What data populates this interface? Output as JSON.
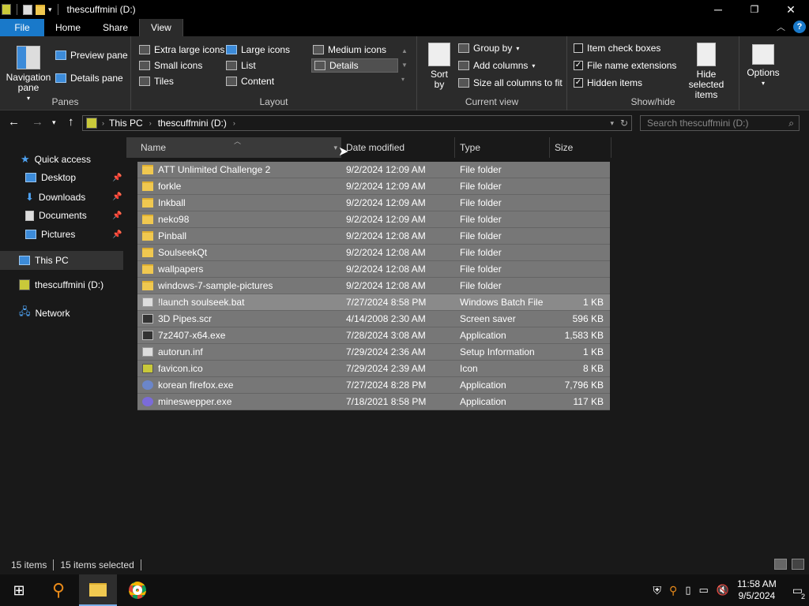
{
  "window": {
    "title": "thescuffmini (D:)",
    "controls": {
      "minimize": "─",
      "maximize": "❐",
      "close": "✕"
    }
  },
  "ribbon_tabs": [
    "File",
    "Home",
    "Share",
    "View"
  ],
  "ribbon": {
    "panes": {
      "navigation_pane": "Navigation pane",
      "preview_pane": "Preview pane",
      "details_pane": "Details pane",
      "label": "Panes"
    },
    "layout": {
      "items": [
        "Extra large icons",
        "Large icons",
        "Medium icons",
        "Small icons",
        "List",
        "Details",
        "Tiles",
        "Content"
      ],
      "selected": "Details",
      "label": "Layout"
    },
    "current_view": {
      "sort_by": "Sort by",
      "group_by": "Group by",
      "add_columns": "Add columns",
      "size_all_columns": "Size all columns to fit",
      "label": "Current view"
    },
    "show_hide": {
      "item_check_boxes": "Item check boxes",
      "file_name_extensions": "File name extensions",
      "hidden_items": "Hidden items",
      "hide_selected_items": "Hide selected items",
      "label": "Show/hide",
      "checks": {
        "item_check_boxes": false,
        "file_name_extensions": true,
        "hidden_items": true
      }
    },
    "options": "Options"
  },
  "address": {
    "crumbs": [
      "This PC",
      "thescuffmini (D:)"
    ],
    "search_placeholder": "Search thescuffmini (D:)"
  },
  "nav_pane": {
    "quick_access": "Quick access",
    "items": [
      "Desktop",
      "Downloads",
      "Documents",
      "Pictures"
    ],
    "this_pc": "This PC",
    "drive": "thescuffmini (D:)",
    "network": "Network"
  },
  "columns": [
    "Name",
    "Date modified",
    "Type",
    "Size"
  ],
  "files": [
    {
      "name": "ATT Unlimited Challenge 2",
      "date": "9/2/2024 12:09 AM",
      "type": "File folder",
      "size": "",
      "icon": "folder"
    },
    {
      "name": "forkle",
      "date": "9/2/2024 12:09 AM",
      "type": "File folder",
      "size": "",
      "icon": "folder"
    },
    {
      "name": "Inkball",
      "date": "9/2/2024 12:09 AM",
      "type": "File folder",
      "size": "",
      "icon": "folder"
    },
    {
      "name": "neko98",
      "date": "9/2/2024 12:09 AM",
      "type": "File folder",
      "size": "",
      "icon": "folder"
    },
    {
      "name": "Pinball",
      "date": "9/2/2024 12:08 AM",
      "type": "File folder",
      "size": "",
      "icon": "folder"
    },
    {
      "name": "SoulseekQt",
      "date": "9/2/2024 12:08 AM",
      "type": "File folder",
      "size": "",
      "icon": "folder"
    },
    {
      "name": "wallpapers",
      "date": "9/2/2024 12:08 AM",
      "type": "File folder",
      "size": "",
      "icon": "folder"
    },
    {
      "name": "windows-7-sample-pictures",
      "date": "9/2/2024 12:08 AM",
      "type": "File folder",
      "size": "",
      "icon": "folder"
    },
    {
      "name": "!launch soulseek.bat",
      "date": "7/27/2024 8:58 PM",
      "type": "Windows Batch File",
      "size": "1 KB",
      "icon": "file"
    },
    {
      "name": "3D Pipes.scr",
      "date": "4/14/2008 2:30 AM",
      "type": "Screen saver",
      "size": "596 KB",
      "icon": "app"
    },
    {
      "name": "7z2407-x64.exe",
      "date": "7/28/2024 3:08 AM",
      "type": "Application",
      "size": "1,583 KB",
      "icon": "app"
    },
    {
      "name": "autorun.inf",
      "date": "7/29/2024 2:36 AM",
      "type": "Setup Information",
      "size": "1 KB",
      "icon": "file"
    },
    {
      "name": "favicon.ico",
      "date": "7/29/2024 2:39 AM",
      "type": "Icon",
      "size": "8 KB",
      "icon": "yel"
    },
    {
      "name": "korean firefox.exe",
      "date": "7/27/2024 8:28 PM",
      "type": "Application",
      "size": "7,796 KB",
      "icon": "fox"
    },
    {
      "name": "mineswepper.exe",
      "date": "7/18/2021 8:58 PM",
      "type": "Application",
      "size": "117 KB",
      "icon": "mine"
    }
  ],
  "status": {
    "items": "15 items",
    "selected": "15 items selected"
  },
  "taskbar": {
    "time": "11:58 AM",
    "date": "9/5/2024",
    "notifications": "2"
  }
}
